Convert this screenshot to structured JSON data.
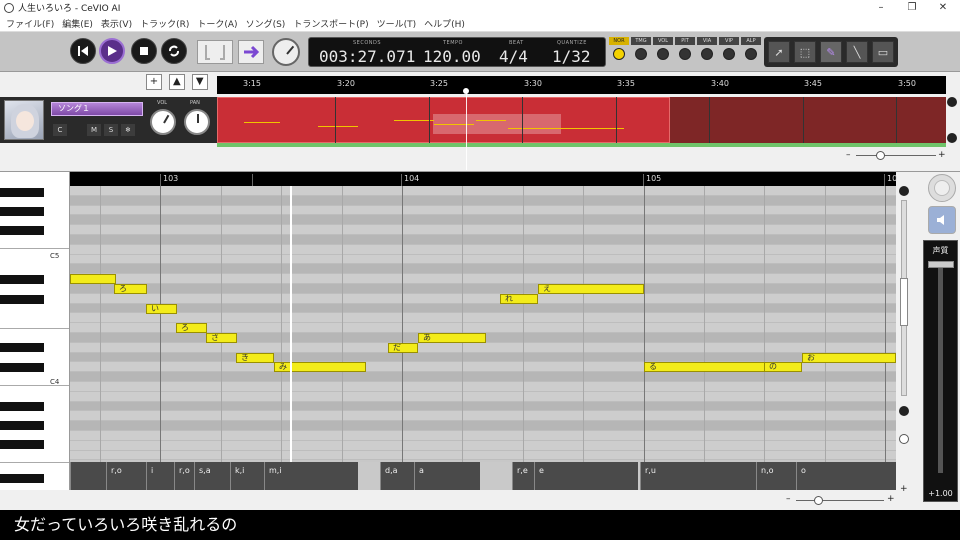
{
  "window": {
    "title": "人生いろいろ - CeVIO AI",
    "minimize": "–",
    "restore": "❐",
    "close": "✕"
  },
  "menu": [
    "ファイル(F)",
    "編集(E)",
    "表示(V)",
    "トラック(R)",
    "トーク(A)",
    "ソング(S)",
    "トランスポート(P)",
    "ツール(T)",
    "ヘルプ(H)"
  ],
  "transport": {
    "display": {
      "seconds_label": "SECONDS",
      "seconds": "003:27.071",
      "tempo_label": "TEMPO",
      "tempo": "120.00",
      "beat_label": "BEAT",
      "beat": "4/4",
      "quantize_label": "QUANTIZE",
      "quantize": "1/32"
    },
    "modes": [
      {
        "label": "NOR",
        "on": true
      },
      {
        "label": "TMG",
        "on": false
      },
      {
        "label": "VOL",
        "on": false
      },
      {
        "label": "PIT",
        "on": false
      },
      {
        "label": "VIA",
        "on": false
      },
      {
        "label": "VIP",
        "on": false
      },
      {
        "label": "ALP",
        "on": false
      }
    ]
  },
  "track_nav": [
    "+",
    "▲",
    "▼"
  ],
  "timeline": [
    "3:15",
    "3:20",
    "3:25",
    "3:30",
    "3:35",
    "3:40",
    "3:45",
    "3:50"
  ],
  "track": {
    "name": "ソング１",
    "buttons": [
      "C",
      "M",
      "S",
      "❄"
    ],
    "vol_label": "VOL",
    "pan_label": "PAN"
  },
  "measures": [
    "103",
    "104",
    "105",
    "10"
  ],
  "key_labels": {
    "c5": "C5",
    "c4": "C4"
  },
  "notes": [
    {
      "lyric": "",
      "row": 9
    },
    {
      "lyric": "ろ",
      "row": 10
    },
    {
      "lyric": "い",
      "row": 12
    },
    {
      "lyric": "ろ",
      "row": 14
    },
    {
      "lyric": "さ",
      "row": 15
    },
    {
      "lyric": "き",
      "row": 17
    },
    {
      "lyric": "み",
      "row": 18
    },
    {
      "lyric": "だ",
      "row": 16
    },
    {
      "lyric": "あ",
      "row": 15
    },
    {
      "lyric": "れ",
      "row": 11
    },
    {
      "lyric": "え",
      "row": 10
    },
    {
      "lyric": "る",
      "row": 18
    },
    {
      "lyric": "の",
      "row": 18
    },
    {
      "lyric": "お",
      "row": 17
    }
  ],
  "phonemes": [
    "",
    "r,o",
    "i",
    "r,o",
    "s,a",
    "k,i",
    "m,i",
    "d,a",
    "a",
    "r,e",
    "e",
    "r,u",
    "n,o",
    "o"
  ],
  "voice_quality": {
    "label": "声質",
    "value": "+1.00"
  },
  "lyric_line": "女だっていろいろ咲き乱れるの"
}
